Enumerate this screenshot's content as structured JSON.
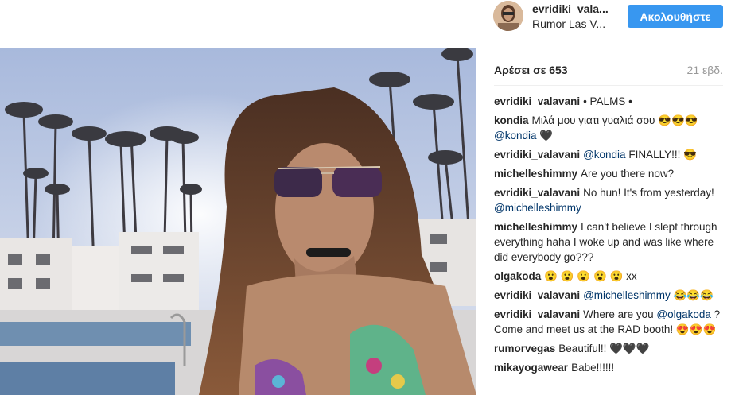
{
  "post": {
    "username": "evridiki_vala...",
    "location": "Rumor Las V...",
    "follow_label": "Ακολουθήστε",
    "likes_label": "Αρέσει σε 653",
    "age_label": "21 εβδ."
  },
  "comments": [
    {
      "user": "evridiki_valavani",
      "text": "• PALMS •",
      "mention": ""
    },
    {
      "user": "kondia",
      "text": "Μιλά μου γιατι γυαλιά σου 😎😎😎",
      "mention": "@kondia 🖤"
    },
    {
      "user": "evridiki_valavani",
      "text": "",
      "mention": "@kondia",
      "text2": "FINALLY!!! 😎"
    },
    {
      "user": "michelleshimmy",
      "text": "Are you there now?",
      "mention": ""
    },
    {
      "user": "evridiki_valavani",
      "text": "No hun! It's from yesterday!",
      "mention": "@michelleshimmy"
    },
    {
      "user": "michelleshimmy",
      "text": "I can't believe I slept through everything haha I woke up and was like where did everybody go???",
      "mention": ""
    },
    {
      "user": "olgakoda",
      "text": "😮 😮 😮 😮 😮 xx",
      "mention": ""
    },
    {
      "user": "evridiki_valavani",
      "text": "",
      "mention": "@michelleshimmy",
      "text2": "😂😂😂"
    },
    {
      "user": "evridiki_valavani",
      "text": "Where are you",
      "mention": "@olgakoda",
      "text2": "? Come and meet us at the RAD booth! 😍😍😍"
    },
    {
      "user": "rumorvegas",
      "text": "Beautiful!! 🖤🖤🖤",
      "mention": ""
    },
    {
      "user": "mikayogawear",
      "text": "Babe!!!!!!",
      "mention": ""
    }
  ],
  "colors": {
    "accent": "#3897f0",
    "mention": "#003569",
    "muted": "#999999"
  }
}
